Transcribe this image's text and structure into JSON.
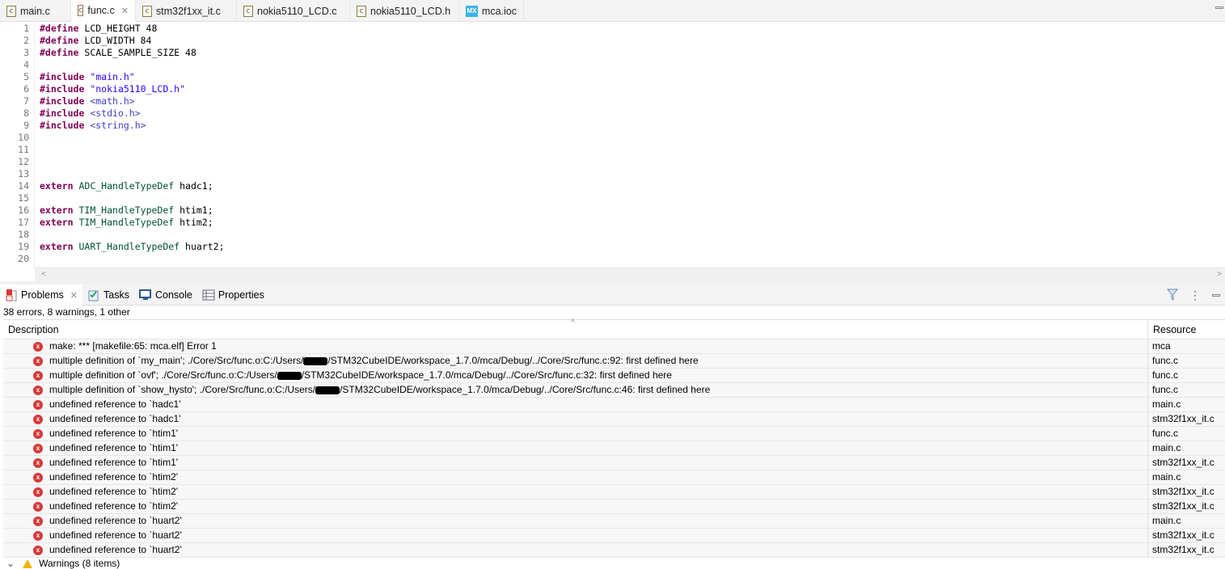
{
  "editor_tabs": [
    {
      "label": "main.c",
      "icon": "c-file-icon"
    },
    {
      "label": "func.c",
      "icon": "c-file-icon",
      "active": true,
      "closable": true
    },
    {
      "label": "stm32f1xx_it.c",
      "icon": "c-file-icon"
    },
    {
      "label": "nokia5110_LCD.c",
      "icon": "c-file-icon"
    },
    {
      "label": "nokia5110_LCD.h",
      "icon": "h-file-icon"
    },
    {
      "label": "mca.ioc",
      "icon": "mx-file-icon",
      "icon_text": "MX"
    }
  ],
  "icon_c_text": "c",
  "code_lines": [
    {
      "n": "1",
      "tokens": [
        [
          "kw",
          "#define"
        ],
        [
          "pl",
          " LCD_HEIGHT 48"
        ]
      ]
    },
    {
      "n": "2",
      "tokens": [
        [
          "kw",
          "#define"
        ],
        [
          "pl",
          " LCD_WIDTH 84"
        ]
      ]
    },
    {
      "n": "3",
      "tokens": [
        [
          "kw",
          "#define"
        ],
        [
          "pl",
          " SCALE_SAMPLE_SIZE 48"
        ]
      ]
    },
    {
      "n": "4",
      "tokens": []
    },
    {
      "n": "5",
      "tokens": [
        [
          "kw",
          "#include"
        ],
        [
          "pl",
          " "
        ],
        [
          "st",
          "\"main.h\""
        ]
      ]
    },
    {
      "n": "6",
      "tokens": [
        [
          "kw",
          "#include"
        ],
        [
          "pl",
          " "
        ],
        [
          "st",
          "\"nokia5110_LCD.h\""
        ]
      ]
    },
    {
      "n": "7",
      "tokens": [
        [
          "kw",
          "#include"
        ],
        [
          "pl",
          " "
        ],
        [
          "in",
          "<math.h>"
        ]
      ]
    },
    {
      "n": "8",
      "tokens": [
        [
          "kw",
          "#include"
        ],
        [
          "pl",
          " "
        ],
        [
          "in",
          "<stdio.h>"
        ]
      ]
    },
    {
      "n": "9",
      "tokens": [
        [
          "kw",
          "#include"
        ],
        [
          "pl",
          " "
        ],
        [
          "in",
          "<string.h>"
        ]
      ]
    },
    {
      "n": "10",
      "tokens": []
    },
    {
      "n": "11",
      "tokens": []
    },
    {
      "n": "12",
      "tokens": []
    },
    {
      "n": "13",
      "tokens": []
    },
    {
      "n": "14",
      "tokens": [
        [
          "kw",
          "extern"
        ],
        [
          "pl",
          " "
        ],
        [
          "ty",
          "ADC_HandleTypeDef"
        ],
        [
          "pl",
          " hadc1;"
        ]
      ]
    },
    {
      "n": "15",
      "tokens": []
    },
    {
      "n": "16",
      "tokens": [
        [
          "kw",
          "extern"
        ],
        [
          "pl",
          " "
        ],
        [
          "ty",
          "TIM_HandleTypeDef"
        ],
        [
          "pl",
          " htim1;"
        ]
      ]
    },
    {
      "n": "17",
      "tokens": [
        [
          "kw",
          "extern"
        ],
        [
          "pl",
          " "
        ],
        [
          "ty",
          "TIM_HandleTypeDef"
        ],
        [
          "pl",
          " htim2;"
        ]
      ]
    },
    {
      "n": "18",
      "tokens": []
    },
    {
      "n": "19",
      "tokens": [
        [
          "kw",
          "extern"
        ],
        [
          "pl",
          " "
        ],
        [
          "ty",
          "UART_HandleTypeDef"
        ],
        [
          "pl",
          " huart2;"
        ]
      ]
    },
    {
      "n": "20",
      "tokens": []
    }
  ],
  "panel_tabs": [
    {
      "label": "Problems",
      "icon": "problems-icon",
      "active": true
    },
    {
      "label": "Tasks",
      "icon": "tasks-icon"
    },
    {
      "label": "Console",
      "icon": "console-icon"
    },
    {
      "label": "Properties",
      "icon": "properties-icon"
    }
  ],
  "status": "38 errors, 8 warnings, 1 other",
  "columns": {
    "description": "Description",
    "resource": "Resource"
  },
  "problems": [
    {
      "desc": "make: *** [makefile:65: mca.elf] Error 1",
      "res": "mca"
    },
    {
      "desc": "multiple definition of `my_main'; ./Core/Src/func.o:C:/Users/",
      "desc2": "/STM32CubeIDE/workspace_1.7.0/mca/Debug/../Core/Src/func.c:92: first defined here",
      "res": "func.c"
    },
    {
      "desc": "multiple definition of `ovf'; ./Core/Src/func.o:C:/Users/",
      "desc2": "/STM32CubeIDE/workspace_1.7.0/mca/Debug/../Core/Src/func.c:32: first defined here",
      "res": "func.c"
    },
    {
      "desc": "multiple definition of `show_hysto'; ./Core/Src/func.o:C:/Users/",
      "desc2": "/STM32CubeIDE/workspace_1.7.0/mca/Debug/../Core/Src/func.c:46: first defined here",
      "res": "func.c"
    },
    {
      "desc": "undefined reference to `hadc1'",
      "res": "main.c"
    },
    {
      "desc": "undefined reference to `hadc1'",
      "res": "stm32f1xx_it.c"
    },
    {
      "desc": "undefined reference to `htim1'",
      "res": "func.c"
    },
    {
      "desc": "undefined reference to `htim1'",
      "res": "main.c"
    },
    {
      "desc": "undefined reference to `htim1'",
      "res": "stm32f1xx_it.c"
    },
    {
      "desc": "undefined reference to `htim2'",
      "res": "main.c"
    },
    {
      "desc": "undefined reference to `htim2'",
      "res": "stm32f1xx_it.c"
    },
    {
      "desc": "undefined reference to `htim2'",
      "res": "stm32f1xx_it.c"
    },
    {
      "desc": "undefined reference to `huart2'",
      "res": "main.c"
    },
    {
      "desc": "undefined reference to `huart2'",
      "res": "stm32f1xx_it.c"
    },
    {
      "desc": "undefined reference to `huart2'",
      "res": "stm32f1xx_it.c"
    }
  ],
  "warnings_group": "Warnings (8 items)",
  "close_glyph": "✕",
  "error_glyph": "x"
}
